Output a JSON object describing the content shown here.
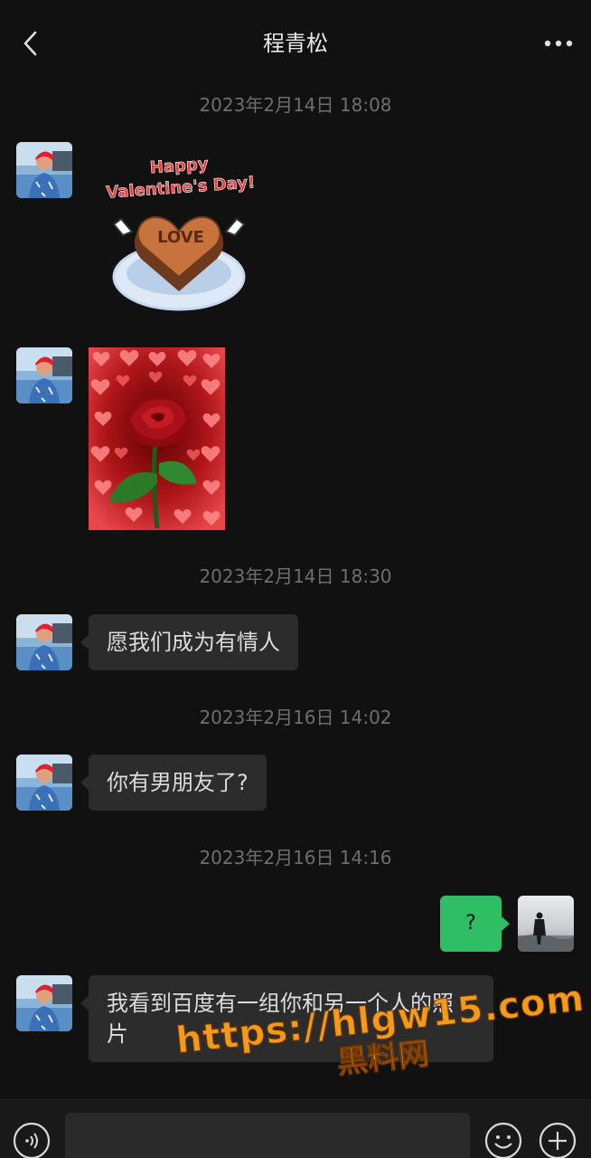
{
  "header": {
    "title": "程青松",
    "back_icon": "chevron-left-icon",
    "more_icon": "more-dots-icon"
  },
  "messages": [
    {
      "type": "timestamp",
      "text": "2023年2月14日 18:08"
    },
    {
      "type": "sticker",
      "from": "contact",
      "sticker_text": "Happy Valentine's Day!",
      "cake_text": "LOVE"
    },
    {
      "type": "image",
      "from": "contact",
      "description": "red-rose-hearts-image"
    },
    {
      "type": "timestamp",
      "text": "2023年2月14日 18:30"
    },
    {
      "type": "text",
      "from": "contact",
      "text": "愿我们成为有情人"
    },
    {
      "type": "timestamp",
      "text": "2023年2月16日 14:02"
    },
    {
      "type": "text",
      "from": "contact",
      "text": "你有男朋友了?"
    },
    {
      "type": "timestamp",
      "text": "2023年2月16日 14:16"
    },
    {
      "type": "text",
      "from": "me",
      "text": "?"
    },
    {
      "type": "text",
      "from": "contact",
      "text_line1": "我看到百度有一组你和另一个人的照",
      "text_line2": "片"
    }
  ],
  "watermark": {
    "url": "https://hlgw15.com",
    "label": "黑料网"
  },
  "input_bar": {
    "voice_icon": "voice-icon",
    "emoji_icon": "emoji-icon",
    "plus_icon": "plus-icon",
    "placeholder": ""
  },
  "colors": {
    "background": "#111111",
    "bubble_incoming": "#2c2c2c",
    "bubble_outgoing": "#2fbe63",
    "timestamp": "#6e6e6e",
    "watermark": "#f39a1a"
  }
}
